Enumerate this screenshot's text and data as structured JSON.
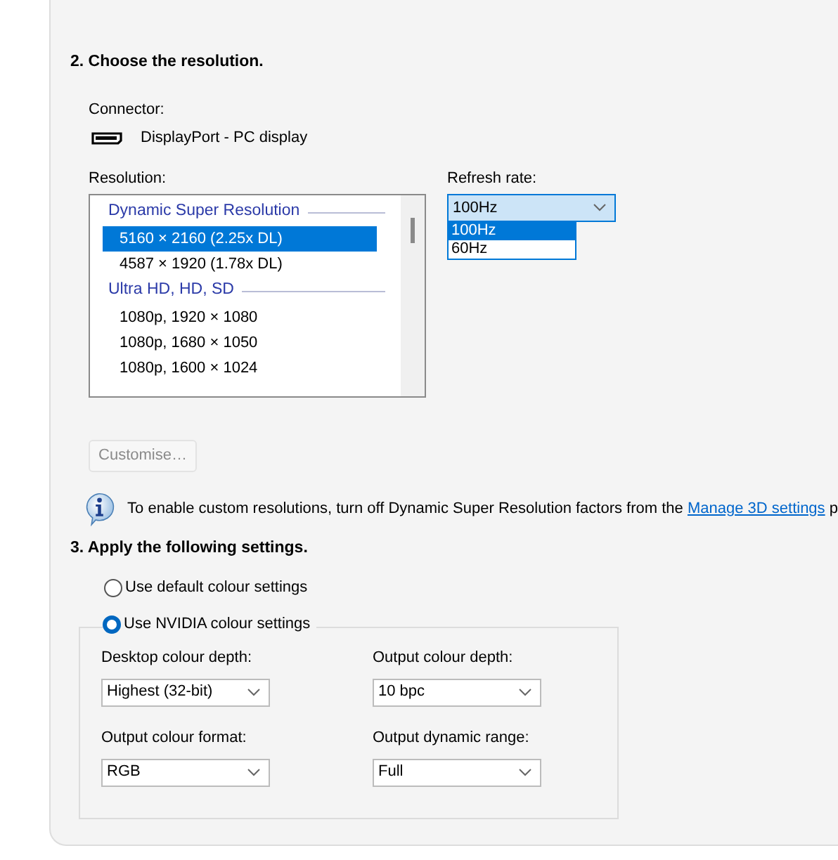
{
  "resolution_section": {
    "heading": "2. Choose the resolution.",
    "connector_label": "Connector:",
    "connector": "DisplayPort - PC display",
    "resolution_label": "Resolution:",
    "resolutions": [
      {
        "kind": "group",
        "label": "Dynamic Super Resolution"
      },
      {
        "kind": "item",
        "label": "5160 × 2160 (2.25x DL)",
        "selected": true
      },
      {
        "kind": "item",
        "label": "4587 × 1920 (1.78x DL)",
        "selected": false
      },
      {
        "kind": "group",
        "label": "Ultra HD, HD, SD"
      },
      {
        "kind": "item",
        "label": "1080p, 1920 × 1080",
        "selected": false
      },
      {
        "kind": "item",
        "label": "1080p, 1680 × 1050",
        "selected": false
      },
      {
        "kind": "item",
        "label": "1080p, 1600 × 1024",
        "selected": false
      }
    ],
    "refresh_label": "Refresh rate:",
    "refresh_value": "100Hz",
    "refresh_options": [
      {
        "label": "100Hz",
        "selected": true
      },
      {
        "label": "60Hz",
        "selected": false
      }
    ],
    "customise_button": {
      "label": "Customise…",
      "disabled": true
    },
    "info": {
      "text": "To enable custom resolutions, turn off Dynamic Super Resolution factors from the ",
      "link": "Manage 3D settings",
      "trailing": " p"
    }
  },
  "apply_section": {
    "heading": "3. Apply the following settings.",
    "colour_modes": [
      {
        "label": "Use default colour settings",
        "selected": false
      },
      {
        "label": "Use NVIDIA colour settings",
        "selected": true
      }
    ],
    "fields": [
      {
        "label": "Desktop colour depth:",
        "value": "Highest (32-bit)"
      },
      {
        "label": "Output colour depth:",
        "value": "10 bpc"
      },
      {
        "label": "Output colour format:",
        "value": "RGB"
      },
      {
        "label": "Output dynamic range:",
        "value": "Full"
      }
    ]
  }
}
